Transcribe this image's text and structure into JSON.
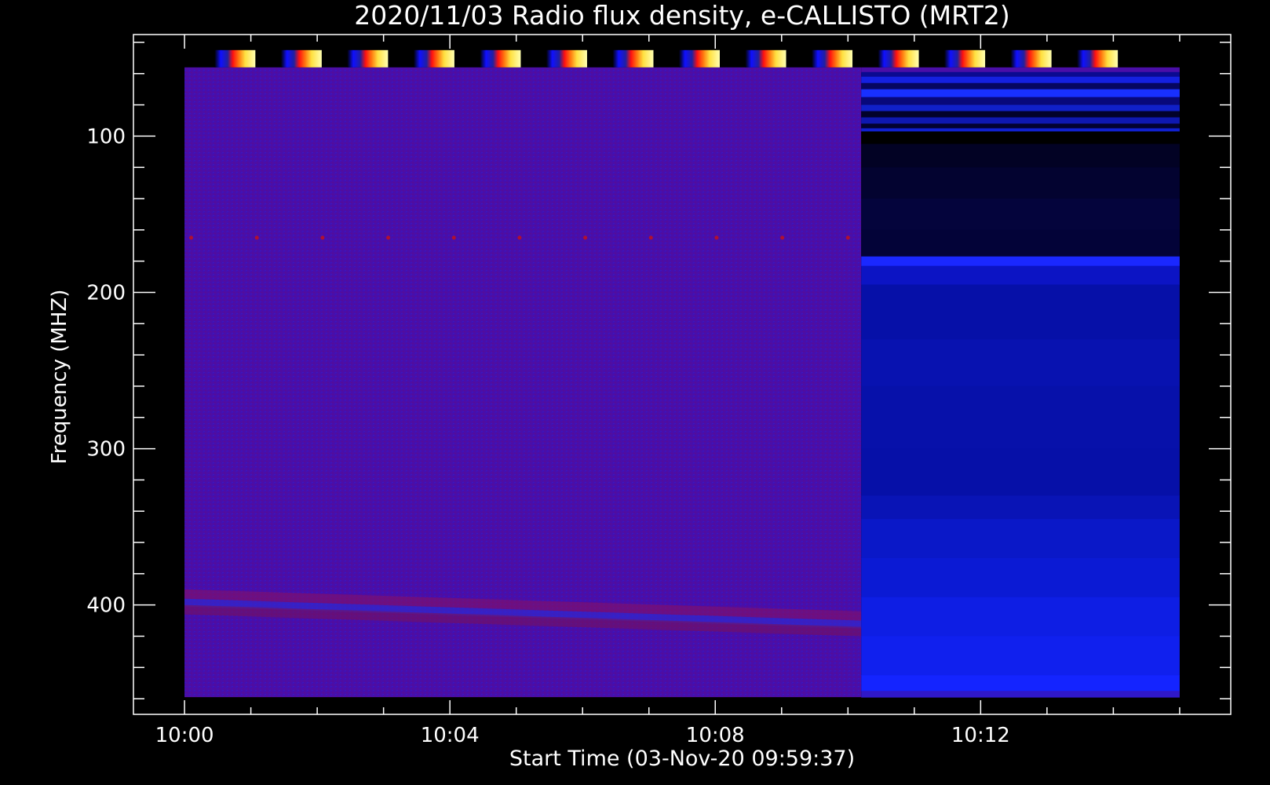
{
  "chart_data": {
    "type": "heatmap",
    "title": "2020/11/03  Radio flux density, e-CALLISTO (MRT2)",
    "xlabel": "Start Time (03-Nov-20 09:59:37)",
    "ylabel": "Frequency (MHZ)",
    "x_tick_labels": [
      "10:00",
      "10:04",
      "10:08",
      "10:12"
    ],
    "x_tick_minutes": [
      0,
      4,
      8,
      12
    ],
    "x_data_range_minutes": [
      0,
      15
    ],
    "x_axis_range_minutes": [
      -0.77,
      15.77
    ],
    "y_tick_values": [
      100,
      200,
      300,
      400
    ],
    "y_data_range": [
      56,
      459
    ],
    "y_axis_range": [
      35,
      470
    ],
    "y_reversed": true,
    "segments": [
      {
        "start_minute": 0,
        "end_minute": 10.2,
        "base_color": "#4a0ea8"
      },
      {
        "start_minute": 10.2,
        "end_minute": 15,
        "base_color": "#0a0aa6"
      }
    ],
    "calibration_markers": 14,
    "colors": {
      "background": "#000000",
      "axes": "#ffffff",
      "text": "#ffffff",
      "segment1": "#4a0ea8",
      "segment2": "#0a0aa6",
      "segment2_dark": "#010122",
      "segment2_bright": "#1a24ff"
    }
  }
}
